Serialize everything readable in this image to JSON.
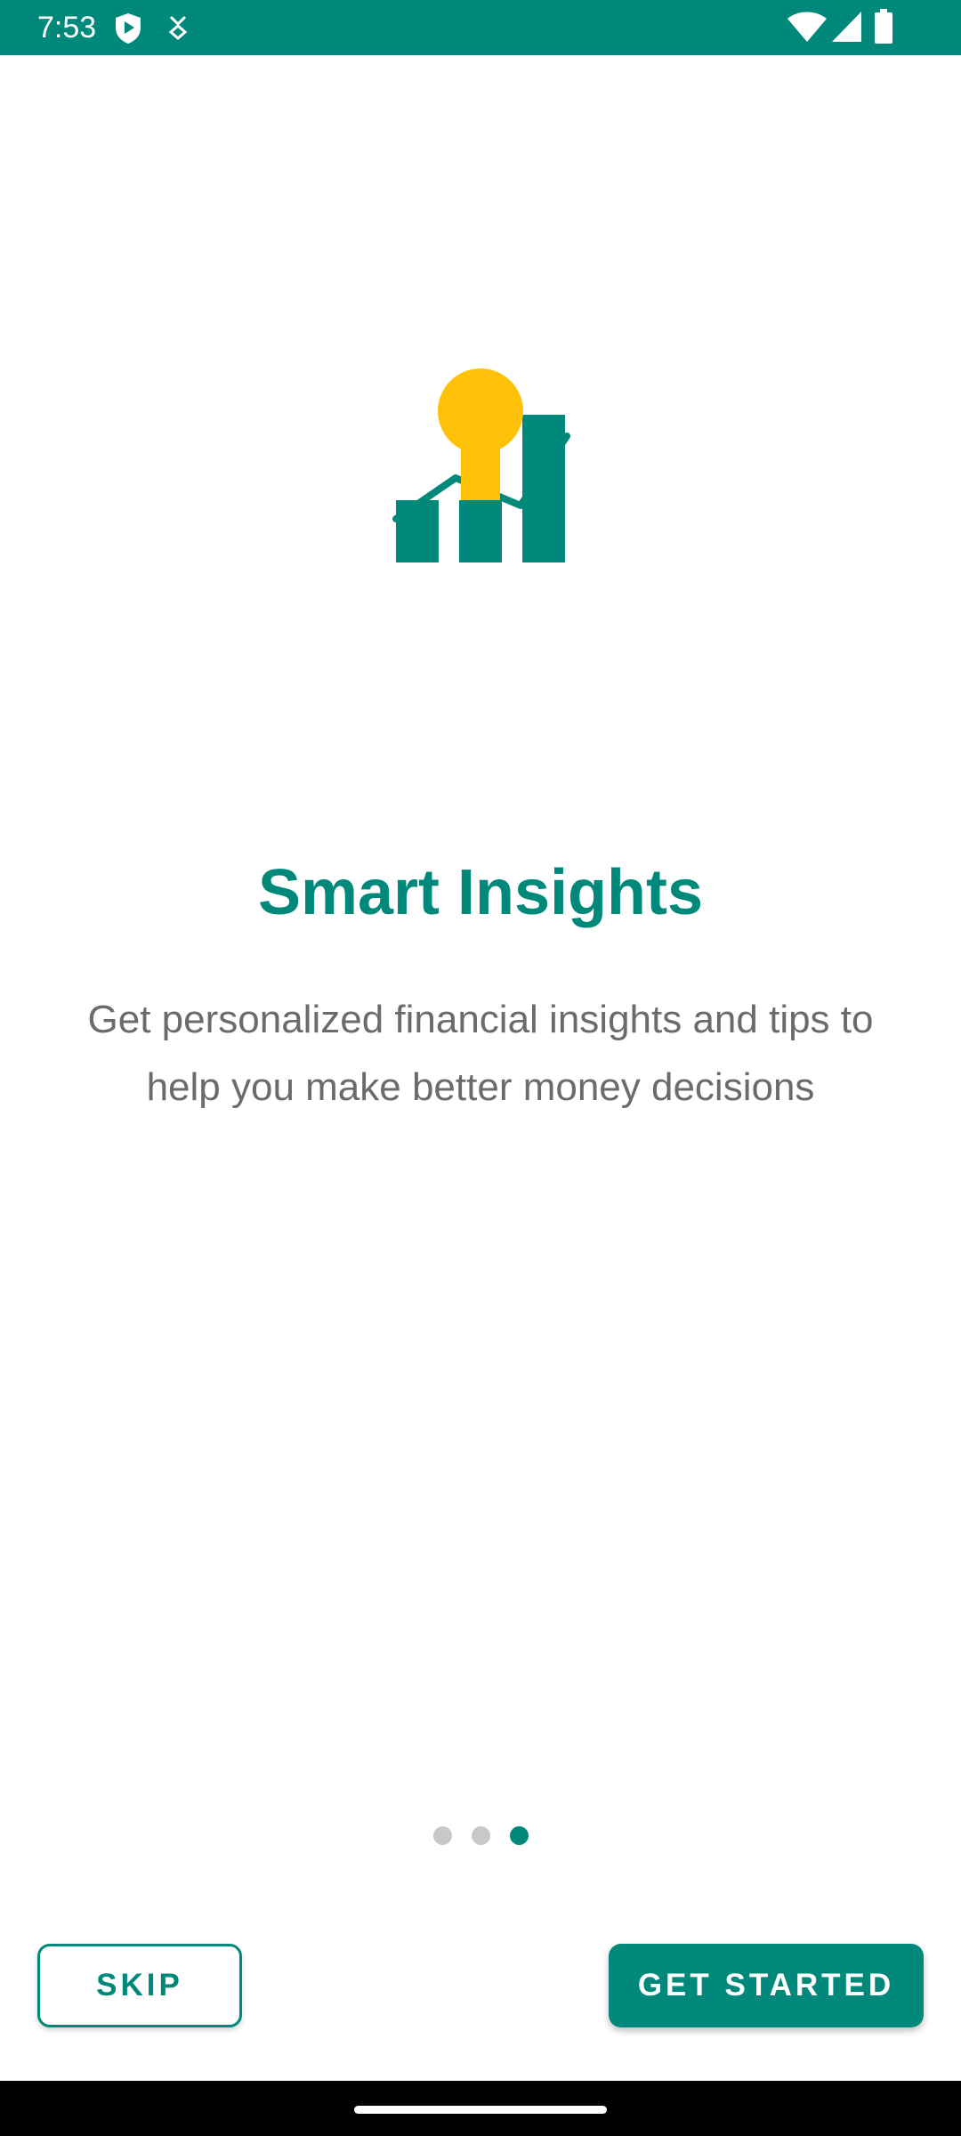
{
  "status_bar": {
    "time": "7:53",
    "background_color": "#00897B",
    "icons": [
      "shield-play-icon",
      "download-icon",
      "wifi-icon",
      "signal-icon",
      "battery-icon"
    ]
  },
  "onboarding": {
    "illustration": "bulb-chart-icon",
    "title": "Smart Insights",
    "description": "Get personalized financial insights and tips to help you make better money decisions",
    "page_count": 3,
    "current_page": 3,
    "accent_color": "#00897B",
    "bulb_color": "#FFC107"
  },
  "actions": {
    "skip_label": "SKIP",
    "get_started_label": "GET STARTED"
  }
}
